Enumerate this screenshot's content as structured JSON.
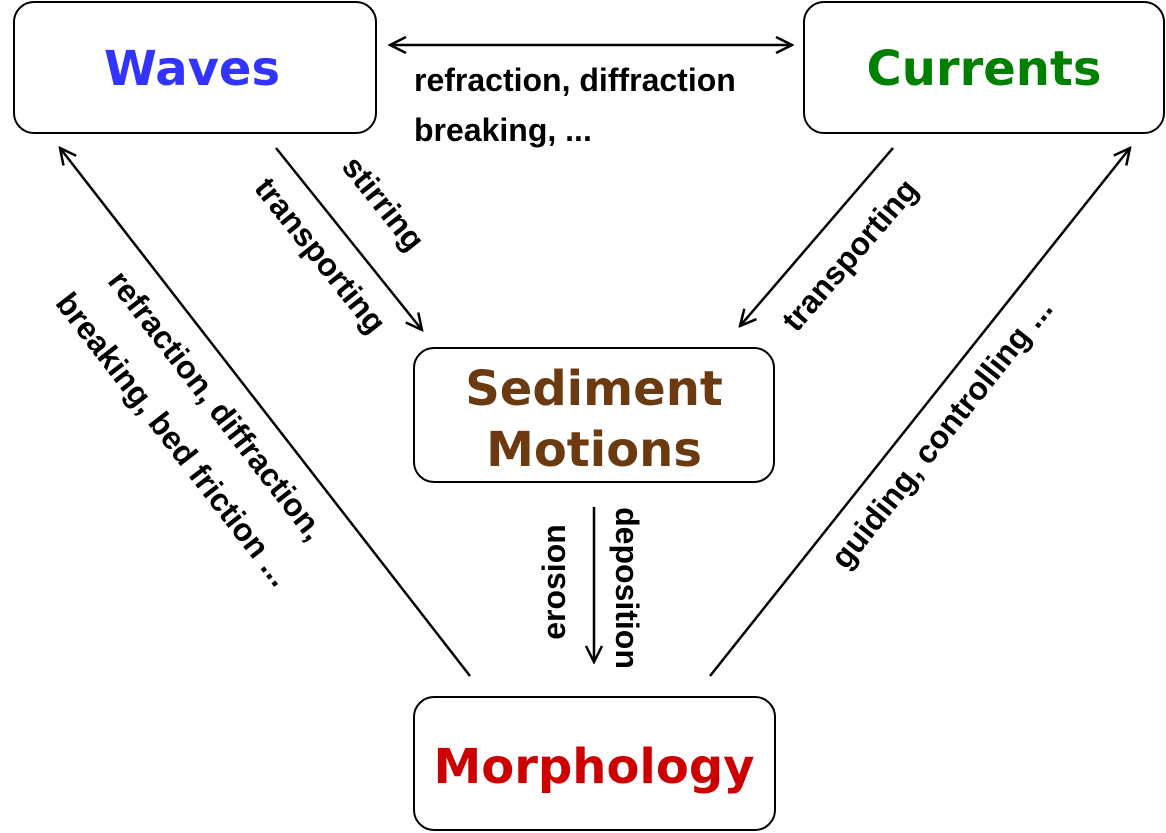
{
  "nodes": {
    "waves": {
      "label": "Waves",
      "color": "#3333ff"
    },
    "currents": {
      "label": "Currents",
      "color": "#008000"
    },
    "sediment": {
      "label_line1": "Sediment",
      "label_line2": "Motions",
      "color": "#6b3a10"
    },
    "morphology": {
      "label": "Morphology",
      "color": "#cc0000"
    }
  },
  "edges": {
    "waves_currents": {
      "line1": "refraction, diffraction",
      "line2": "breaking, ..."
    },
    "waves_sediment": {
      "upper": "stirring",
      "lower": "transporting"
    },
    "currents_sediment": {
      "label": "transporting"
    },
    "morphology_waves": {
      "line1": "refraction, diffraction,",
      "line2": "breaking, bed friction ..."
    },
    "morphology_currents": {
      "label": "guiding, controlling ..."
    },
    "sediment_morphology": {
      "left": "erosion",
      "right": "deposition"
    }
  }
}
